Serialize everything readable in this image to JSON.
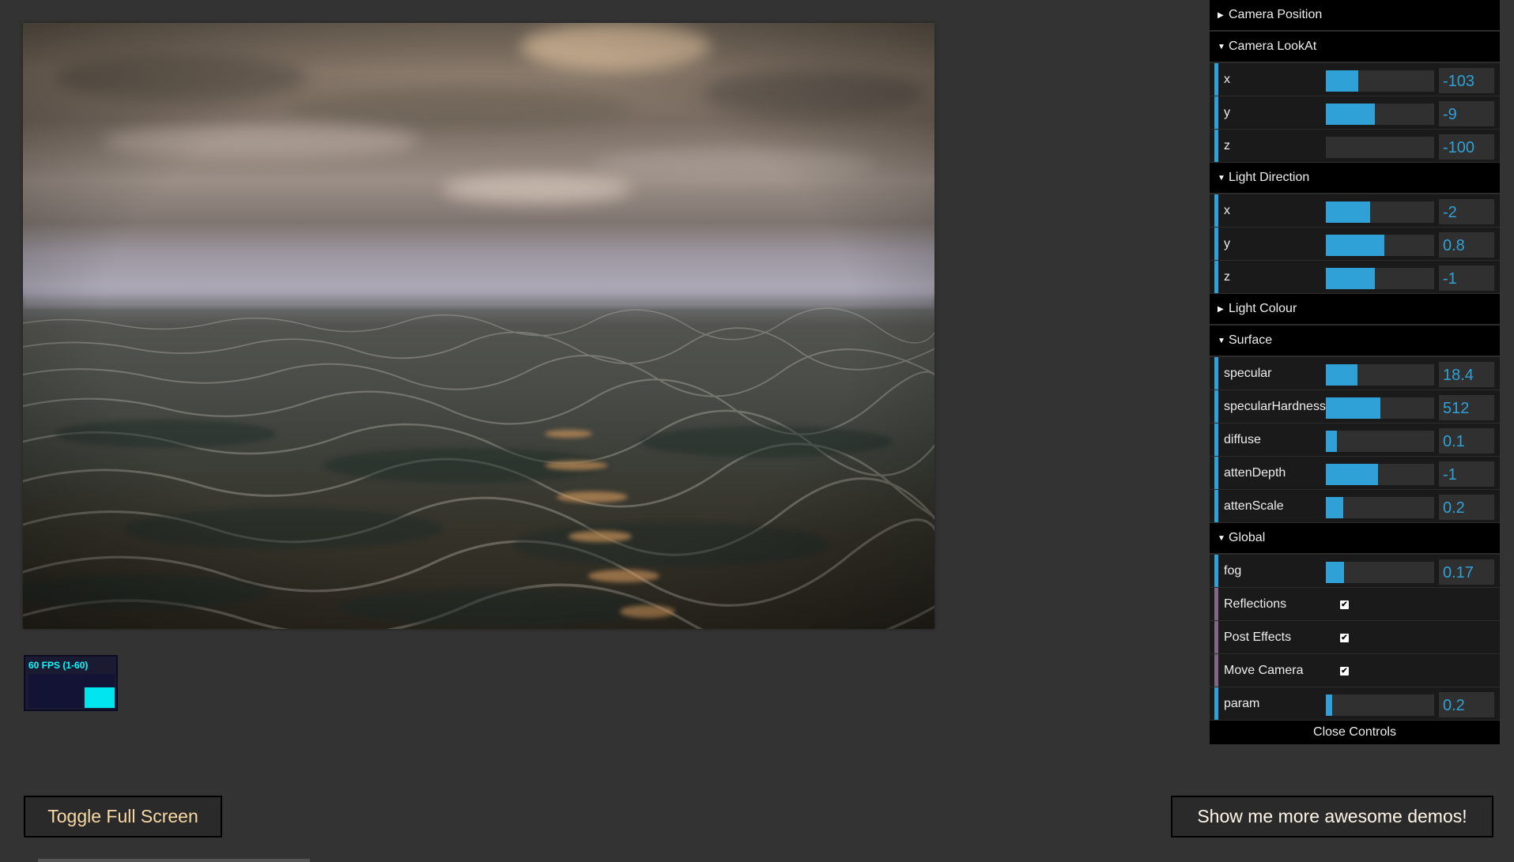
{
  "fps": {
    "label": "60 FPS (1-60)",
    "level": 0.6
  },
  "buttons": {
    "fullscreen": "Toggle Full Screen",
    "demos": "Show me more awesome demos!"
  },
  "gui": {
    "camera_position": {
      "title": "Camera Position",
      "collapsed": true
    },
    "camera_lookat": {
      "title": "Camera LookAt",
      "x": {
        "label": "x",
        "value": "-103",
        "fill": 0.3
      },
      "y": {
        "label": "y",
        "value": "-9",
        "fill": 0.45
      },
      "z": {
        "label": "z",
        "value": "-100",
        "fill": 0.0
      }
    },
    "light_direction": {
      "title": "Light Direction",
      "x": {
        "label": "x",
        "value": "-2",
        "fill": 0.41
      },
      "y": {
        "label": "y",
        "value": "0.8",
        "fill": 0.54
      },
      "z": {
        "label": "z",
        "value": "-1",
        "fill": 0.45
      }
    },
    "light_colour": {
      "title": "Light Colour",
      "collapsed": true
    },
    "surface": {
      "title": "Surface",
      "specular": {
        "label": "specular",
        "value": "18.4",
        "fill": 0.29
      },
      "specular_hardness": {
        "label": "specularHardness",
        "value": "512",
        "fill": 0.5
      },
      "diffuse": {
        "label": "diffuse",
        "value": "0.1",
        "fill": 0.1
      },
      "atten_depth": {
        "label": "attenDepth",
        "value": "-1",
        "fill": 0.48
      },
      "atten_scale": {
        "label": "attenScale",
        "value": "0.2",
        "fill": 0.16
      }
    },
    "global": {
      "title": "Global",
      "fog": {
        "label": "fog",
        "value": "0.17",
        "fill": 0.17
      },
      "reflections": {
        "label": "Reflections",
        "checked": true
      },
      "post_effects": {
        "label": "Post Effects",
        "checked": true
      },
      "move_camera": {
        "label": "Move Camera",
        "checked": true
      },
      "param": {
        "label": "param",
        "value": "0.2",
        "fill": 0.06
      }
    },
    "close_label": "Close Controls"
  },
  "colors": {
    "accent": "#2fa1d6",
    "bool_accent": "#806787",
    "background": "#333333"
  }
}
